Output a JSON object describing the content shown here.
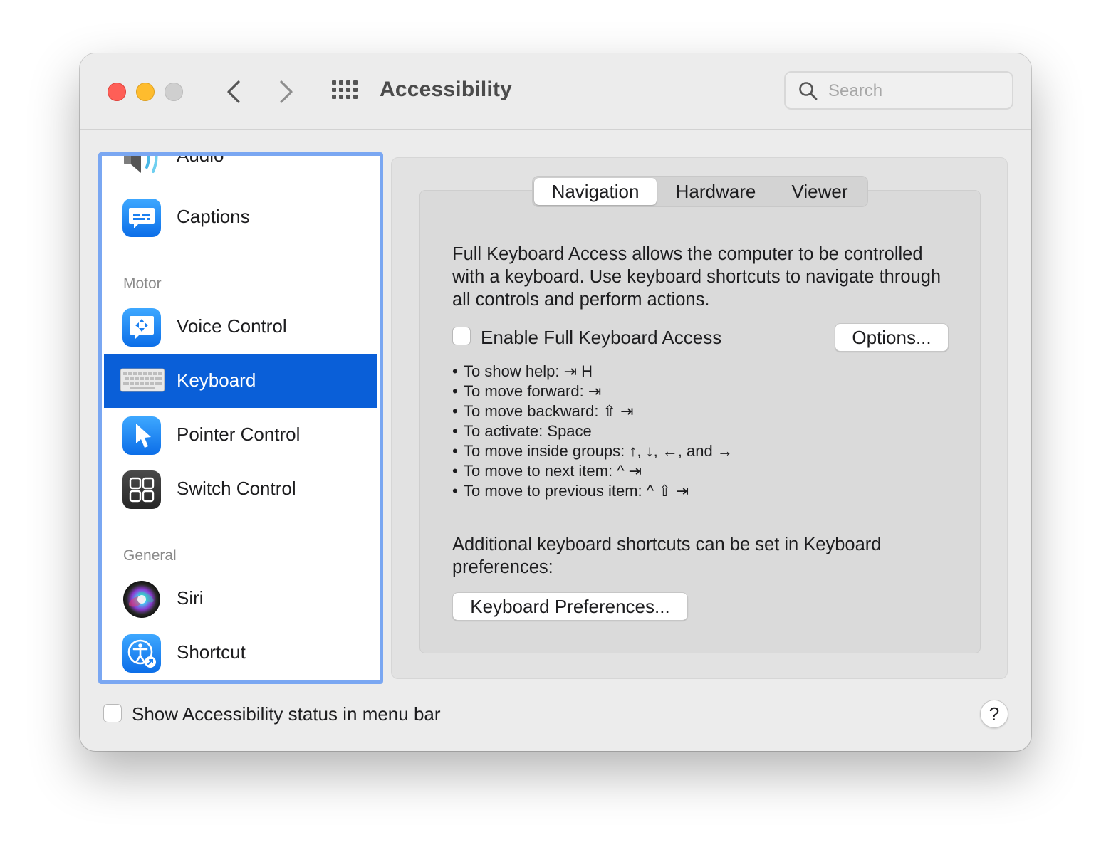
{
  "window": {
    "title": "Accessibility",
    "search_placeholder": "Search"
  },
  "sidebar": {
    "items": [
      {
        "label": "Audio",
        "icon": "speaker-icon"
      },
      {
        "label": "Captions",
        "icon": "captions-icon"
      },
      {
        "label": "Voice Control",
        "icon": "voice-control-icon"
      },
      {
        "label": "Keyboard",
        "icon": "keyboard-icon",
        "selected": true
      },
      {
        "label": "Pointer Control",
        "icon": "pointer-icon"
      },
      {
        "label": "Switch Control",
        "icon": "switch-control-icon"
      },
      {
        "label": "Siri",
        "icon": "siri-icon"
      },
      {
        "label": "Shortcut",
        "icon": "accessibility-shortcut-icon"
      }
    ],
    "headers": {
      "motor": "Motor",
      "general": "General"
    }
  },
  "tabs": [
    {
      "label": "Navigation",
      "active": true
    },
    {
      "label": "Hardware"
    },
    {
      "label": "Viewer"
    }
  ],
  "content": {
    "description": "Full Keyboard Access allows the computer to be controlled with a keyboard. Use keyboard shortcuts to navigate through all controls and perform actions.",
    "enable_label": "Enable Full Keyboard Access",
    "enable_checked": false,
    "options_button": "Options...",
    "shortcuts": [
      "To show help: ⇥ H",
      "To move forward: ⇥",
      "To move backward: ⇧ ⇥",
      "To activate: Space",
      "To move inside groups: ↑, ↓, ←, and →",
      "To move to next item: ^ ⇥",
      "To move to previous item: ^ ⇧ ⇥"
    ],
    "bullet": "•",
    "additional": "Additional keyboard shortcuts can be set in Keyboard preferences:",
    "keyboard_prefs_button": "Keyboard Preferences..."
  },
  "footer": {
    "status_label": "Show Accessibility status in menu bar",
    "status_checked": false,
    "help": "?"
  },
  "colors": {
    "selection": "#0a5fd8",
    "focus_ring": "#7aa7f2",
    "close": "#fe5f57",
    "minimize": "#febc2e",
    "zoom_disabled": "#cfcfcf"
  }
}
